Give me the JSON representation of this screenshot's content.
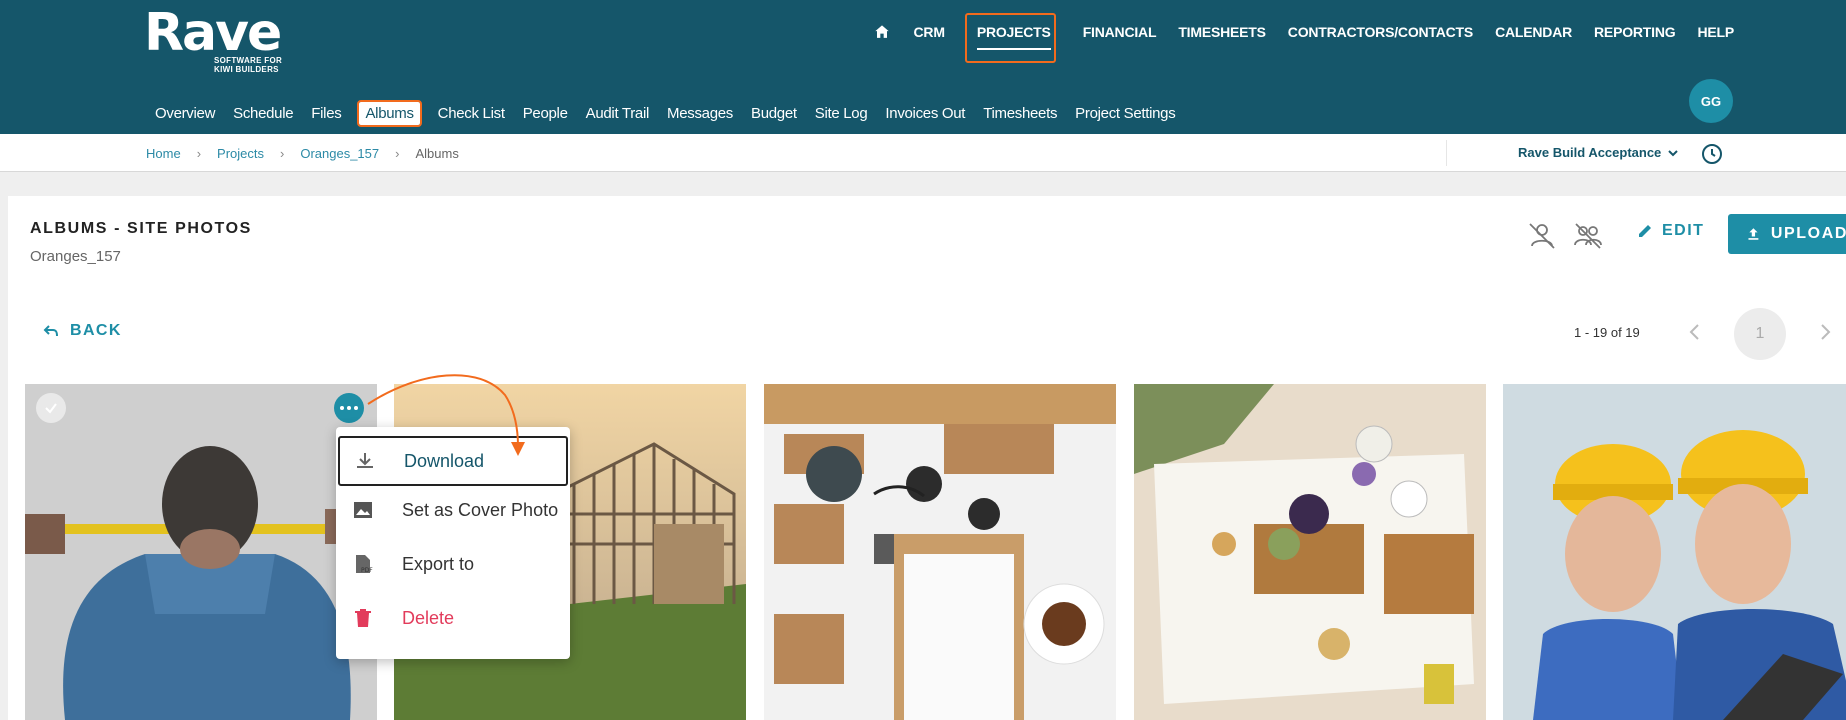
{
  "brand": {
    "name": "Rave",
    "tagline_line1": "SOFTWARE FOR",
    "tagline_line2": "KIWI BUILDERS"
  },
  "main_nav": {
    "items": [
      "CRM",
      "PROJECTS",
      "FINANCIAL",
      "TIMESHEETS",
      "CONTRACTORS/CONTACTS",
      "CALENDAR",
      "REPORTING",
      "HELP"
    ],
    "active": "PROJECTS"
  },
  "project_nav": {
    "items": [
      "Overview",
      "Schedule",
      "Files",
      "Albums",
      "Check List",
      "People",
      "Audit Trail",
      "Messages",
      "Budget",
      "Site Log",
      "Invoices Out",
      "Timesheets",
      "Project Settings"
    ],
    "active": "Albums"
  },
  "user": {
    "initials": "GG"
  },
  "breadcrumb": {
    "items": [
      "Home",
      "Projects",
      "Oranges_157"
    ],
    "current": "Albums"
  },
  "workspace": {
    "name": "Rave Build Acceptance"
  },
  "album": {
    "title": "ALBUMS - SITE PHOTOS",
    "project": "Oranges_157"
  },
  "actions": {
    "edit": "EDIT",
    "upload": "UPLOAD",
    "back": "BACK"
  },
  "pagination": {
    "range": "1 - 19 of 19",
    "page": "1"
  },
  "context_menu": {
    "download": "Download",
    "cover": "Set as Cover Photo",
    "export": "Export to",
    "delete": "Delete"
  },
  "colors": {
    "header_bg": "#15566a",
    "accent": "#1e8ea6",
    "highlight": "#f26b1d",
    "danger": "#e23b5b"
  },
  "icons": [
    "home-icon",
    "user-off-icon",
    "group-off-icon",
    "pencil-icon",
    "upload-icon",
    "back-arrow-icon",
    "chevron-left-icon",
    "chevron-right-icon",
    "download-icon",
    "image-icon",
    "pdf-icon",
    "trash-icon",
    "history-icon",
    "chevron-down-icon",
    "check-icon",
    "more-icon"
  ]
}
